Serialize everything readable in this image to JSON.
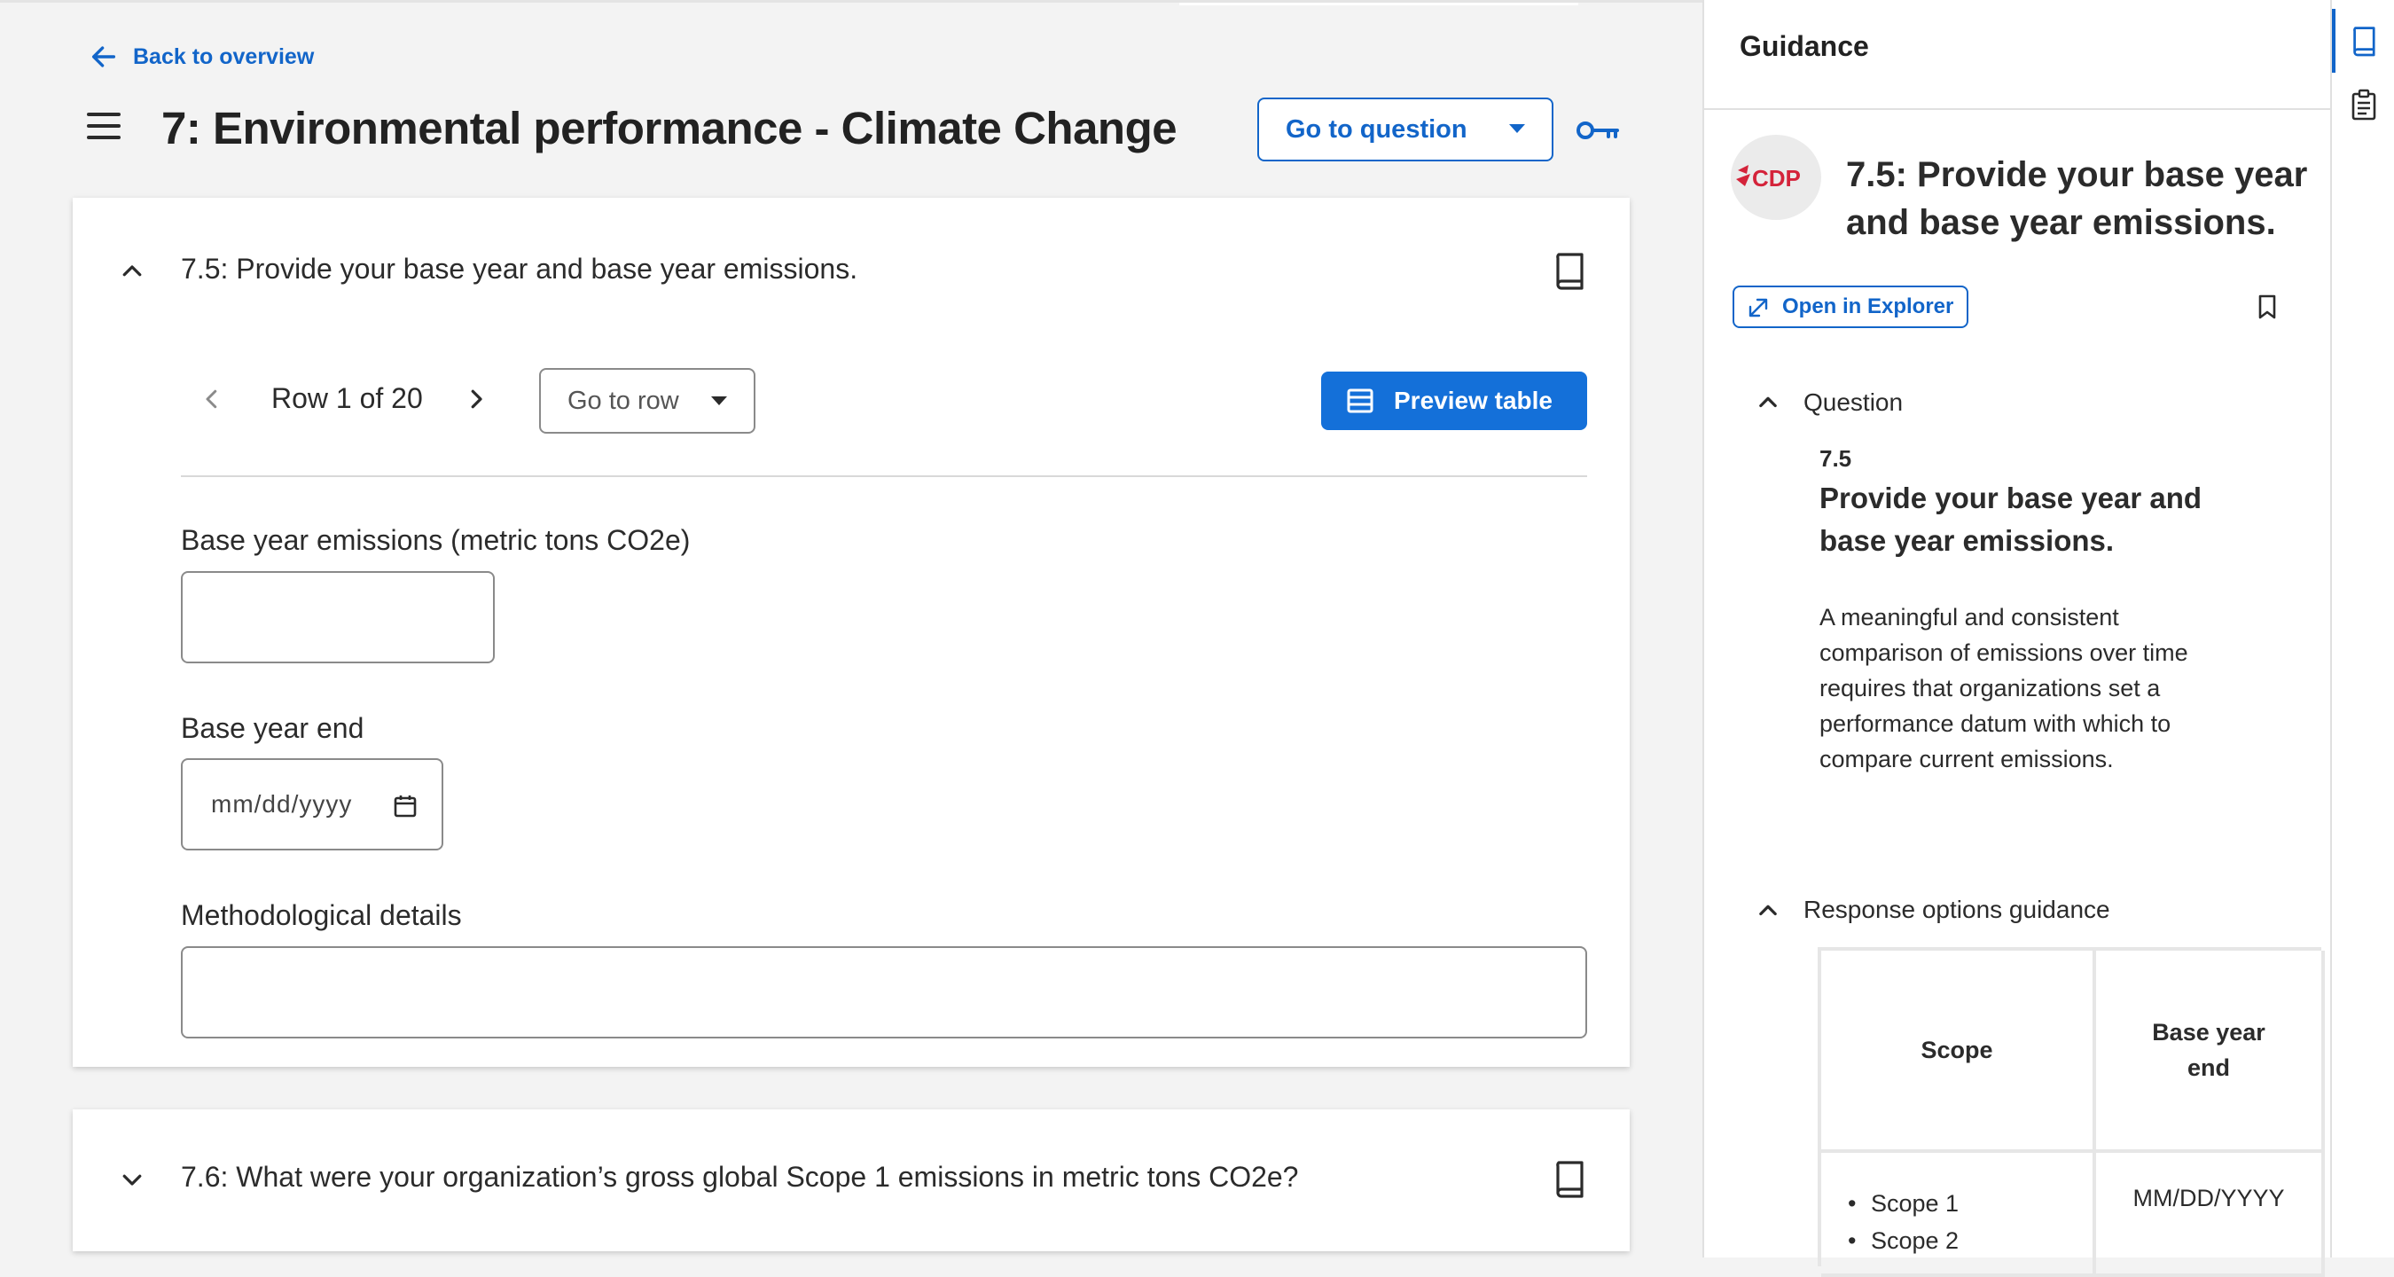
{
  "nav": {
    "back_label": "Back to overview"
  },
  "header": {
    "title": "7: Environmental performance - Climate Change",
    "goto_question_label": "Go to question"
  },
  "question_7_5": {
    "title": "7.5: Provide your base year and base year emissions.",
    "row_label": "Row 1 of 20",
    "goto_row_label": "Go to row",
    "preview_table_label": "Preview table",
    "fields": {
      "emissions_label": "Base year emissions (metric tons CO2e)",
      "emissions_value": "",
      "end_label": "Base year end",
      "end_placeholder": "mm/dd/yyyy",
      "method_label": "Methodological details",
      "method_value": ""
    }
  },
  "question_7_6": {
    "title": "7.6: What were your organization’s gross global Scope 1 emissions in metric tons CO2e?"
  },
  "guidance": {
    "panel_title": "Guidance",
    "logo_text": "CDP",
    "question_title": "7.5: Provide your base year and base year emissions.",
    "open_explorer_label": "Open in Explorer",
    "question_section_label": "Question",
    "question_number": "7.5",
    "question_text": "Provide your base year and base year emissions.",
    "question_body": "A meaningful and consistent comparison of emissions over time requires that organizations set a performance datum with which to compare current emissions.",
    "response_section_label": "Response options guidance",
    "table": {
      "headers": [
        "Scope",
        "Base year end"
      ],
      "scope_items": [
        "Scope 1",
        "Scope 2"
      ],
      "end_value": "MM/DD/YYYY"
    }
  },
  "colors": {
    "accent": "#1265c9",
    "primary_button": "#1470d9",
    "brand_red": "#d4233a"
  },
  "icons": {
    "back": "arrow-left-icon",
    "menu": "hamburger-icon",
    "key": "key-icon",
    "book": "book-icon",
    "table": "table-icon",
    "calendar": "calendar-icon",
    "external": "expand-icon",
    "bookmark": "bookmark-icon",
    "clipboard": "clipboard-icon"
  }
}
